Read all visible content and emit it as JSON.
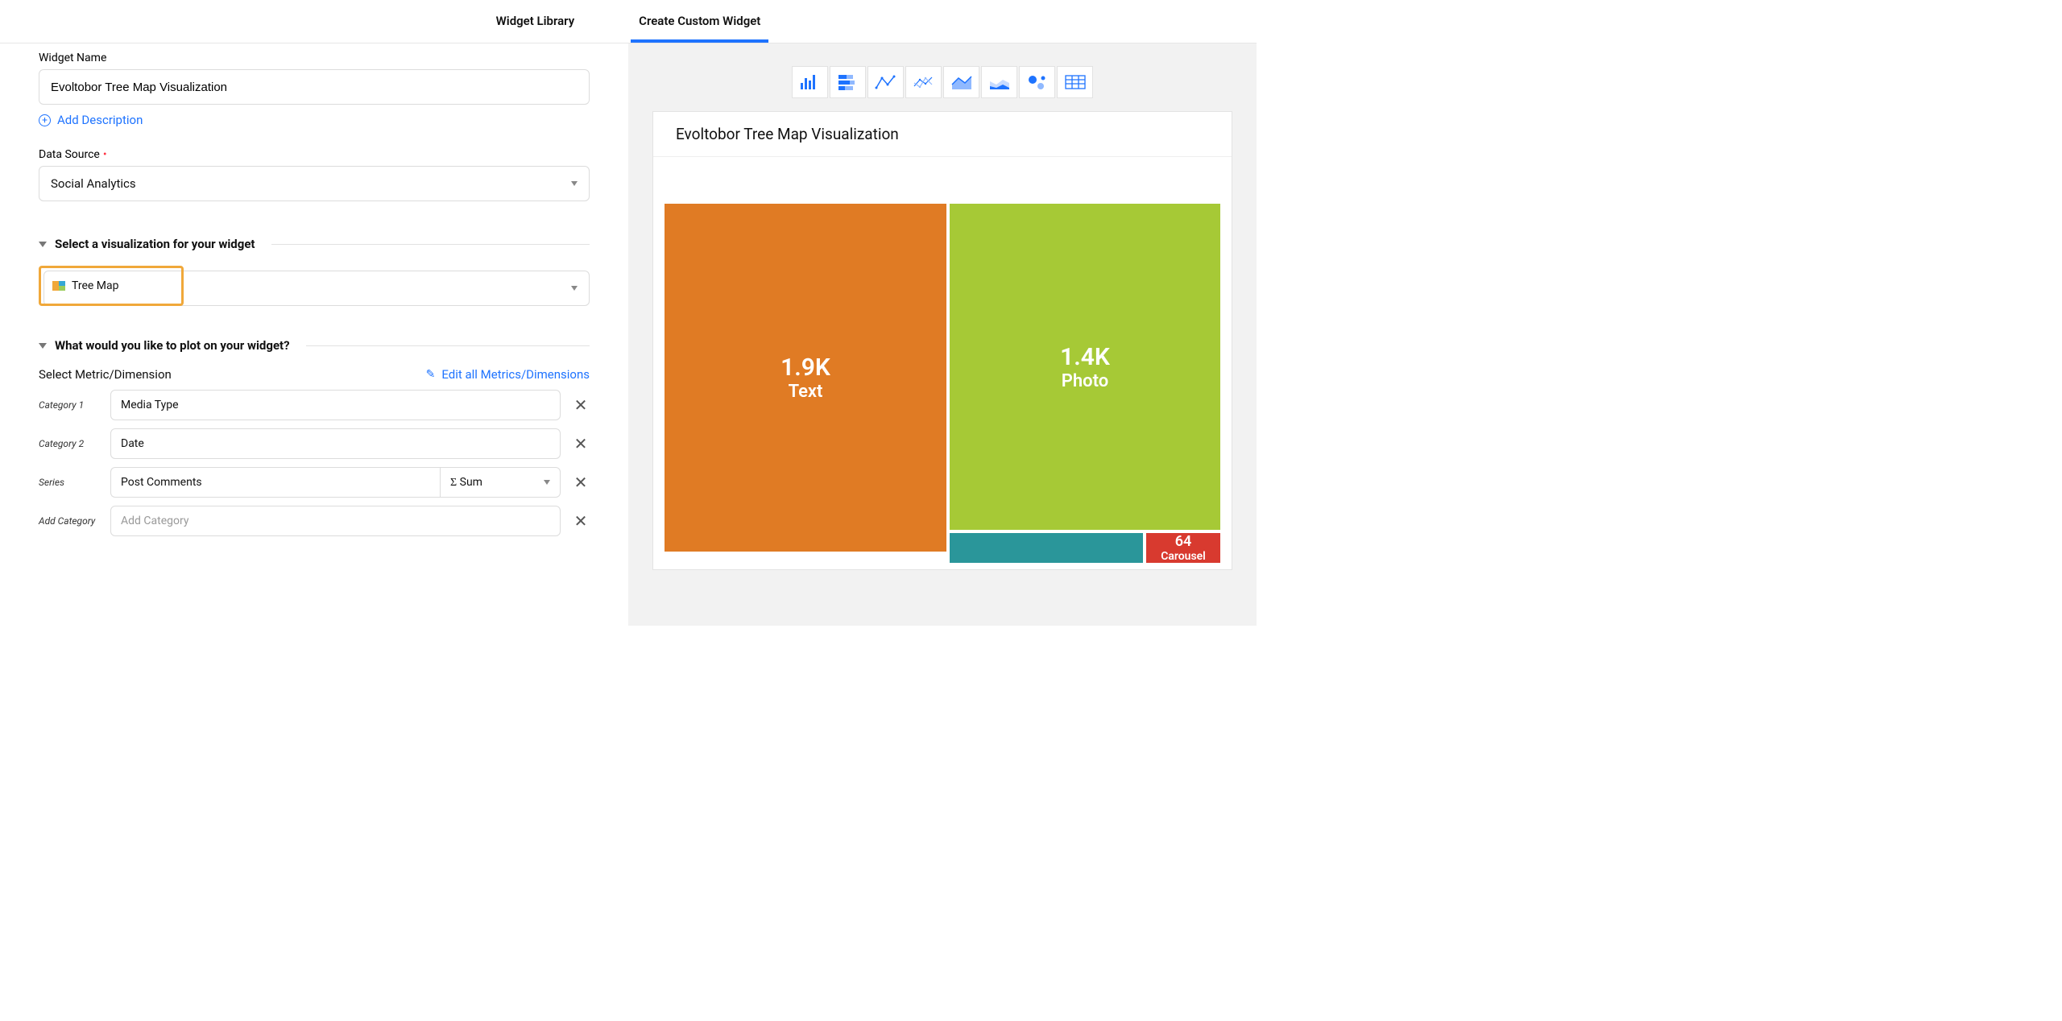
{
  "tabs": {
    "library": "Widget Library",
    "create": "Create Custom Widget"
  },
  "form": {
    "widget_name_label": "Widget Name",
    "widget_name_value": "Evoltobor Tree Map Visualization",
    "add_description": "Add Description",
    "data_source_label": "Data Source",
    "data_source_value": "Social Analytics",
    "select_viz_title": "Select a visualization for your widget",
    "viz_value": "Tree Map",
    "plot_title": "What would you like to plot on your widget?",
    "select_metric_label": "Select Metric/Dimension",
    "edit_all_label": "Edit all Metrics/Dimensions",
    "rows": {
      "cat1_label": "Category 1",
      "cat1_value": "Media Type",
      "cat2_label": "Category 2",
      "cat2_value": "Date",
      "series_label": "Series",
      "series_value": "Post Comments",
      "series_agg": "Sum",
      "addcat_label": "Add Category",
      "addcat_placeholder": "Add Category"
    }
  },
  "preview": {
    "title": "Evoltobor Tree Map Visualization",
    "icons": [
      "bar-chart-icon",
      "stacked-bar-icon",
      "line-chart-icon",
      "multiline-icon",
      "area-chart-icon",
      "stacked-area-icon",
      "bubble-chart-icon",
      "table-icon"
    ]
  },
  "chart_data": {
    "type": "treemap",
    "title": "Evoltobor Tree Map Visualization",
    "series": [
      {
        "label": "Text",
        "value_display": "1.9K",
        "value": 1900,
        "color": "#e07b24"
      },
      {
        "label": "Photo",
        "value_display": "1.4K",
        "value": 1400,
        "color": "#a6c936"
      },
      {
        "label": "",
        "value_display": "",
        "value": 300,
        "color": "#2a969a"
      },
      {
        "label": "Carousel",
        "value_display": "64",
        "value": 64,
        "color": "#d83a2f"
      }
    ]
  }
}
